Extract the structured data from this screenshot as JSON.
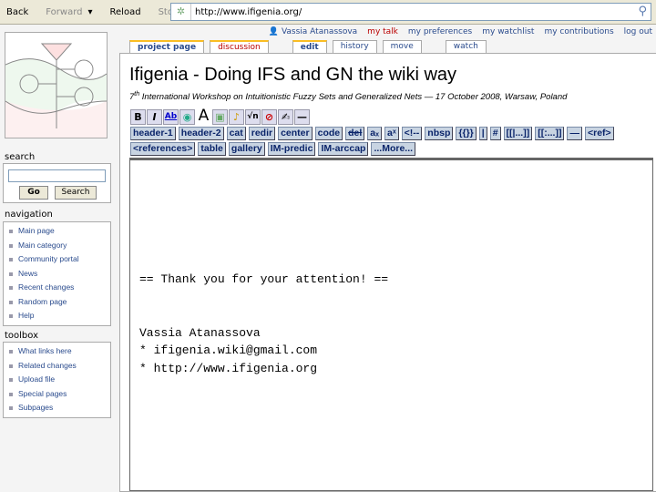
{
  "browser": {
    "back": "Back",
    "forward": "Forward",
    "reload": "Reload",
    "stop": "Stop",
    "url": "http://www.ifigenia.org/"
  },
  "user": {
    "name": "Vassia Atanassova",
    "links": [
      "my talk",
      "my preferences",
      "my watchlist",
      "my contributions",
      "log out"
    ]
  },
  "tabs": [
    "project page",
    "discussion",
    "edit",
    "history",
    "move",
    "watch"
  ],
  "page": {
    "title": "Ifigenia - Doing IFS and GN the wiki way",
    "sub_sup": "th",
    "sub_num": "7",
    "subtitle": " International Workshop on Intuitionistic Fuzzy Sets and Generalized Nets — 17 October 2008, Warsaw, Poland"
  },
  "toolbar": {
    "icons": [
      "bold",
      "italic",
      "link",
      "external-link",
      "headline",
      "image",
      "media",
      "math",
      "nowiki",
      "signature",
      "hr"
    ],
    "row1": [
      "header-1",
      "header-2",
      "cat",
      "redir",
      "center",
      "code",
      "del",
      "aₓ",
      "aˣ",
      "<!--",
      "nbsp",
      "{{}}",
      "|",
      "#",
      "[[|...]]",
      "[[:...]]",
      "—",
      "<ref>"
    ],
    "row2": [
      "<references>",
      "table",
      "gallery",
      "IM-predic",
      "IM-arccap",
      "...More..."
    ]
  },
  "editor": {
    "text": "\n\n\n\n\n\n== Thank you for your attention! ==\n\n\nVassia Atanassova\n* ifigenia.wiki@gmail.com\n* http://www.ifigenia.org"
  },
  "sidebar": {
    "search": {
      "title": "search",
      "go": "Go",
      "search": "Search"
    },
    "navigation": {
      "title": "navigation",
      "items": [
        "Main page",
        "Main category",
        "Community portal",
        "News",
        "Recent changes",
        "Random page",
        "Help"
      ]
    },
    "toolbox": {
      "title": "toolbox",
      "items": [
        "What links here",
        "Related changes",
        "Upload file",
        "Special pages",
        "Subpages"
      ]
    }
  }
}
